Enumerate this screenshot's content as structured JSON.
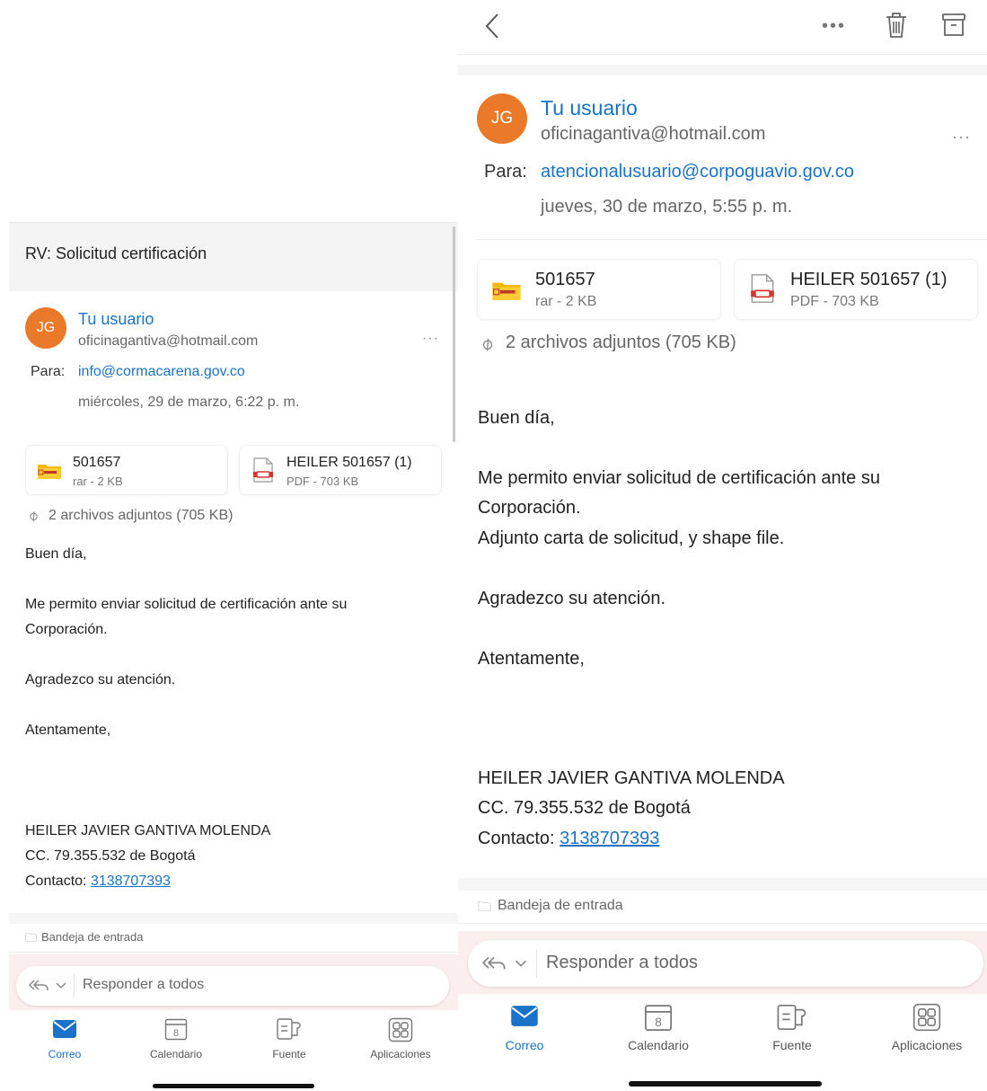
{
  "left": {
    "subject": "RV: Solicitud certificación",
    "sender_name": "Tu usuario",
    "sender_email": "oficinagantiva@hotmail.com",
    "avatar_initials": "JG",
    "to_label": "Para:",
    "to_address": "info@cormacarena.gov.co",
    "date": "miércoles, 29 de marzo, 6:22 p. m.",
    "attachments": [
      {
        "name": "501657",
        "meta": "rar - 2 KB"
      },
      {
        "name": "HEILER 501657 (1)",
        "meta": "PDF - 703 KB"
      }
    ],
    "attachments_summary": "2 archivos adjuntos (705 KB)",
    "body": {
      "greeting": "Buen día,",
      "p1_line1": "Me permito enviar solicitud de certificación ante su",
      "p1_line2": "Corporación.",
      "thanks": "Agradezco su atención.",
      "closing": "Atentamente,",
      "sig_name": "HEILER JAVIER GANTIVA MOLENDA",
      "sig_cc": "CC. 79.355.532 de Bogotá",
      "sig_contact_label": "Contacto: ",
      "sig_phone": "3138707393"
    },
    "folder": "Bandeja de entrada",
    "reply_all": "Responder a todos",
    "tabs": [
      "Correo",
      "Calendario",
      "Fuente",
      "Aplicaciones"
    ],
    "calendar_day": "8"
  },
  "right": {
    "sender_name": "Tu usuario",
    "sender_email": "oficinagantiva@hotmail.com",
    "avatar_initials": "JG",
    "to_label": "Para:",
    "to_address": "atencionalusuario@corpoguavio.gov.co",
    "date": "jueves, 30 de marzo, 5:55 p. m.",
    "attachments": [
      {
        "name": "501657",
        "meta": "rar - 2 KB"
      },
      {
        "name": "HEILER 501657 (1)",
        "meta": "PDF - 703 KB"
      }
    ],
    "attachments_summary": "2 archivos adjuntos (705 KB)",
    "body": {
      "greeting": "Buen día,",
      "p1_line1": "Me permito enviar solicitud de certificación ante su",
      "p1_line2": "Corporación.",
      "p1_line3": "Adjunto carta de solicitud, y shape file.",
      "thanks": "Agradezco su atención.",
      "closing": "Atentamente,",
      "sig_name": "HEILER JAVIER GANTIVA MOLENDA",
      "sig_cc": "CC. 79.355.532 de Bogotá",
      "sig_contact_label": "Contacto: ",
      "sig_phone": "3138707393"
    },
    "folder": "Bandeja de entrada",
    "reply_all": "Responder a todos",
    "tabs": [
      "Correo",
      "Calendario",
      "Fuente",
      "Aplicaciones"
    ],
    "calendar_day": "8"
  },
  "colors": {
    "accent": "#1a73c9",
    "avatar": "#ea7a2a",
    "rar_folder": "#f5b700",
    "pdf_red": "#d9342b"
  }
}
